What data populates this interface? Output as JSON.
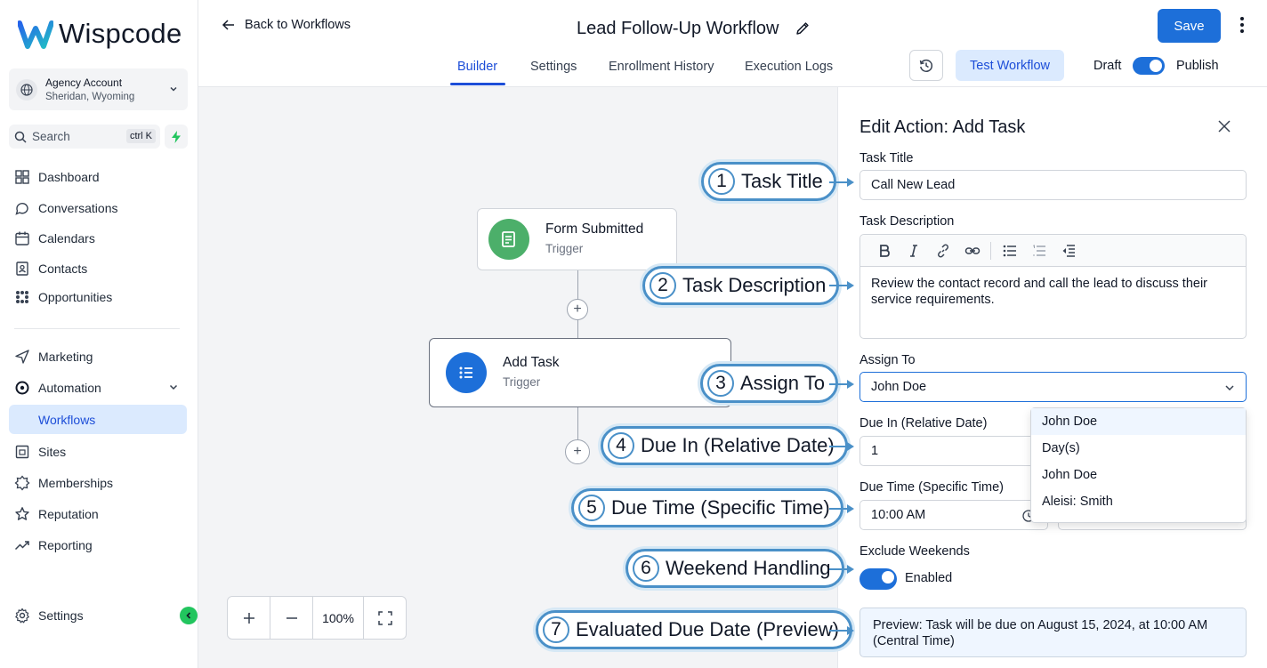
{
  "brand": {
    "name": "Wispcode"
  },
  "account": {
    "name": "Agency Account",
    "location": "Sheridan, Wyoming"
  },
  "search": {
    "label": "Search",
    "shortcut": "ctrl K"
  },
  "nav": {
    "dashboard": "Dashboard",
    "conversations": "Conversations",
    "calendars": "Calendars",
    "contacts": "Contacts",
    "opportunities": "Opportunities",
    "marketing": "Marketing",
    "automation": "Automation",
    "workflows": "Workflows",
    "sites": "Sites",
    "memberships": "Memberships",
    "reputation": "Reputation",
    "reporting": "Reporting",
    "settings": "Settings"
  },
  "header": {
    "back": "Back to Workflows",
    "title": "Lead Follow-Up Workflow",
    "save": "Save",
    "tabs": [
      "Builder",
      "Settings",
      "Enrollment History",
      "Execution Logs"
    ],
    "test": "Test Workflow",
    "draft": "Draft",
    "publish": "Publish"
  },
  "canvas": {
    "trigger": {
      "title": "Form Submitted",
      "subtitle": "Trigger"
    },
    "action": {
      "title": "Add Task",
      "subtitle": "Trigger"
    },
    "zoom": "100%"
  },
  "panel": {
    "title": "Edit Action: Add Task",
    "task_title_label": "Task Title",
    "task_title_value": "Call New Lead",
    "desc_label": "Task Description",
    "desc_value": "Review the contact record and call the lead to discuss their service requirements.",
    "assign_label": "Assign To",
    "assign_value": "John Doe",
    "due_in_label": "Due In (Relative Date)",
    "due_in_value": "1",
    "due_time_label": "Due Time (Specific Time)",
    "due_time_value": "10:00 AM",
    "weekend_label": "Exclude Weekends",
    "weekend_status": "Enabled",
    "preview": "Preview: Task will be due on August 15, 2024, at 10:00 AM (Central Time)",
    "dropdown_options": [
      "John Doe",
      "Day(s)",
      "John Doe",
      "Aleisi: Smith"
    ]
  },
  "callouts": [
    {
      "num": "1",
      "label": "Task Title"
    },
    {
      "num": "2",
      "label": "Task Description"
    },
    {
      "num": "3",
      "label": "Assign To"
    },
    {
      "num": "4",
      "label": "Due In (Relative Date)"
    },
    {
      "num": "5",
      "label": "Due Time (Specific Time)"
    },
    {
      "num": "6",
      "label": "Weekend Handling"
    },
    {
      "num": "7",
      "label": "Evaluated Due Date (Preview)"
    }
  ],
  "colors": {
    "accent": "#1d6fd9",
    "trigger_icon": "#4caf6a",
    "callout_border": "#4a90c8"
  }
}
